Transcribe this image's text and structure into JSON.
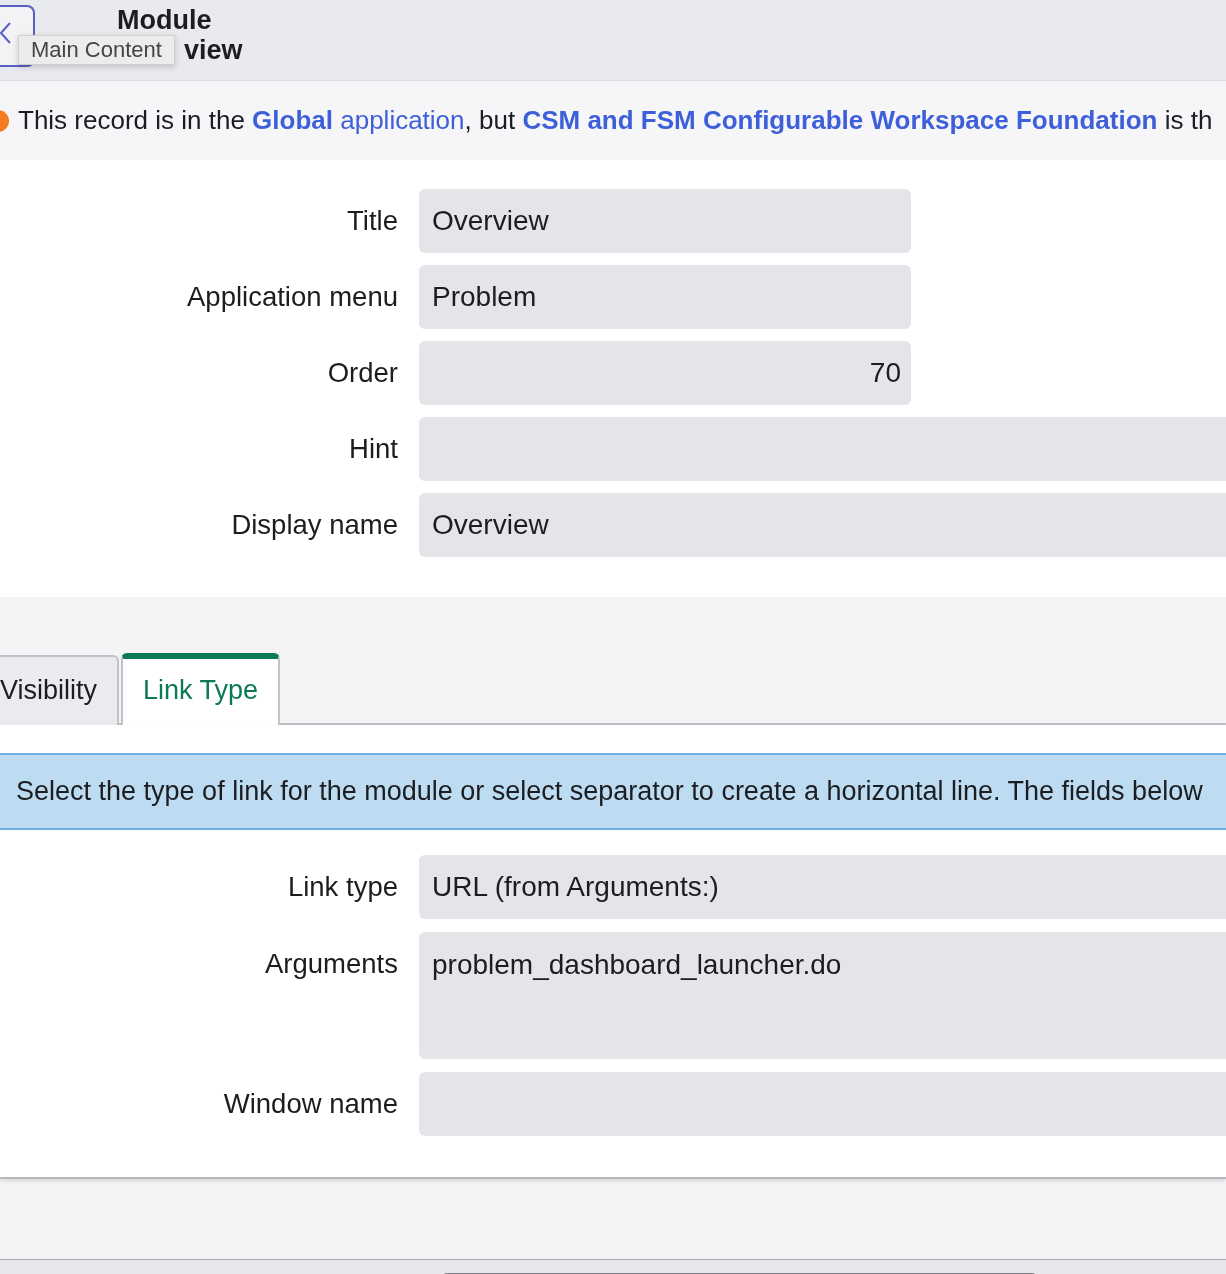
{
  "header": {
    "back_button": {
      "tooltip": "Main Content"
    },
    "title_lines": [
      "Module",
      "view"
    ]
  },
  "notice": {
    "parts": [
      {
        "kind": "text",
        "text": "This record is in the "
      },
      {
        "kind": "link",
        "text": "**Global** application",
        "bold": false
      },
      {
        "kind": "text",
        "text": ", but "
      },
      {
        "kind": "link",
        "text": "CSM and FSM Configurable Workspace Foundation",
        "bold": true
      },
      {
        "kind": "text",
        "text": " is th"
      }
    ]
  },
  "form_fields": [
    {
      "label": "Title",
      "kind": "short_text",
      "value": "Overview"
    },
    {
      "label": "Application menu",
      "kind": "short_text",
      "value": "Problem"
    },
    {
      "label": "Order",
      "kind": "integer",
      "value": "70"
    },
    {
      "label": "Hint",
      "kind": "long_text"
    },
    {
      "label": "Display name",
      "kind": "long_text",
      "value": "Overview"
    }
  ],
  "tabs": [
    {
      "label": "Visibility",
      "selected": false
    },
    {
      "label": "Link Type",
      "selected": true
    }
  ],
  "tab_panel": {
    "info": "Select the type of link for the module or select separator to create a horizontal line. The fields below",
    "fields": [
      {
        "label": "Link type",
        "kind": "long_text",
        "value": "URL (from Arguments:)"
      },
      {
        "label": "Arguments",
        "kind": "multiline",
        "value": "problem_dashboard_launcher.do"
      },
      {
        "label": "Window name",
        "kind": "long_text"
      }
    ]
  }
}
